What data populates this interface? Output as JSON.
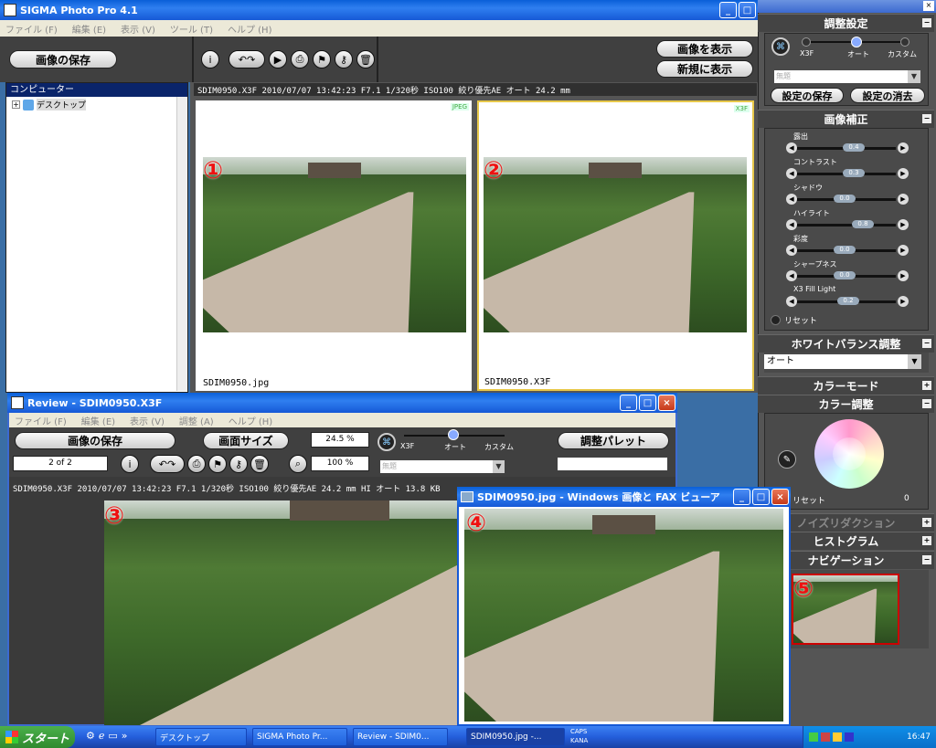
{
  "main_window": {
    "title": "SIGMA Photo Pro 4.1",
    "menu": [
      "ファイル (F)",
      "編集 (E)",
      "表示 (V)",
      "ツール (T)",
      "ヘルプ (H)"
    ],
    "save_button": "画像の保存",
    "show_image_button": "画像を表示",
    "new_show_button": "新規に表示",
    "sidebar_header": "コンピューター",
    "tree_item": "デスクトップ",
    "info_line": "SDIM0950.X3F  2010/07/07  13:42:23  F7.1  1/320秒  ISO100  絞り優先AE  オート  24.2  mm",
    "thumb1_label": "SDIM0950.jpg",
    "thumb1_badge": "JPEG",
    "thumb2_label": "SDIM0950.X3F",
    "thumb2_badge": "X3F",
    "markers": [
      "①",
      "②",
      "③",
      "④",
      "⑤"
    ]
  },
  "review_window": {
    "title": "Review - SDIM0950.X3F",
    "menu": [
      "ファイル (F)",
      "編集 (E)",
      "表示 (V)",
      "調整 (A)",
      "ヘルプ (H)"
    ],
    "save_button": "画像の保存",
    "screen_size_button": "画面サイズ",
    "zoom_value": "24.5 %",
    "zoom2_value": "100 %",
    "page_counter": "2 of 2",
    "mode_x3f": "X3F",
    "mode_auto": "オート",
    "mode_custom": "カスタム",
    "preset_placeholder": "無題",
    "palette_button": "調整パレット",
    "info_line": "SDIM0950.X3F  2010/07/07  13:42:23  F7.1  1/320秒  ISO100  絞り優先AE  24.2  mm  HI  オート  13.8 KB"
  },
  "viewer_window": {
    "title": "SDIM0950.jpg - Windows 画像と FAX ビューア"
  },
  "palette": {
    "adjust_settings_header": "調整設定",
    "mode_x3f": "X3F",
    "mode_auto": "オート",
    "mode_custom": "カスタム",
    "preset_value": "無題",
    "save_settings_button": "設定の保存",
    "clear_settings_button": "設定の消去",
    "image_correction_header": "画像補正",
    "sliders": [
      {
        "label": "露出",
        "value": "0.4"
      },
      {
        "label": "コントラスト",
        "value": "0.3"
      },
      {
        "label": "シャドウ",
        "value": "0.0"
      },
      {
        "label": "ハイライト",
        "value": "0.8"
      },
      {
        "label": "彩度",
        "value": "0.0"
      },
      {
        "label": "シャープネス",
        "value": "0.0"
      },
      {
        "label": "X3 Fill Light",
        "value": "0.2"
      }
    ],
    "reset_label": "リセット",
    "white_balance_header": "ホワイトバランス調整",
    "white_balance_value": "オート",
    "color_mode_header": "カラーモード",
    "color_adjust_header": "カラー調整",
    "color_reset_label": "リセット",
    "color_value": "0",
    "noise_header": "ノイズリダクション",
    "histogram_header": "ヒストグラム",
    "navigation_header": "ナビゲーション"
  },
  "taskbar": {
    "start_label": "スタート",
    "tasks": [
      "デスクトップ",
      "SIGMA Photo Pr...",
      "Review - SDIM0...",
      "SDIM0950.jpg -..."
    ],
    "caps": "CAPS",
    "kana": "KANA",
    "clock": "16:47"
  }
}
